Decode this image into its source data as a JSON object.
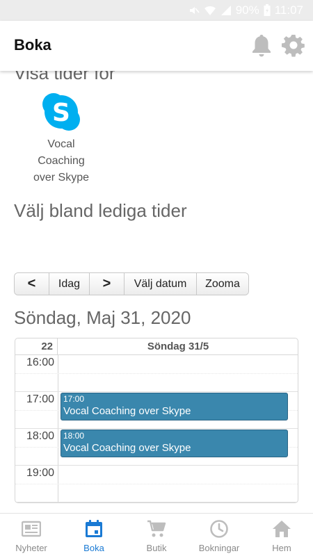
{
  "status_bar": {
    "battery": "90%",
    "time": "11:07"
  },
  "header": {
    "title": "Boka",
    "bell_icon": "bell-icon",
    "settings_icon": "gear-icon"
  },
  "main": {
    "visa_heading": "Visa tider för",
    "service": {
      "label": "Vocal Coaching over Skype",
      "icon": "skype-icon",
      "brand_color": "#00aff0"
    },
    "valj_heading": "Välj bland lediga tider",
    "toolbar": {
      "prev": "<",
      "today": "Idag",
      "next": ">",
      "pick_date": "Välj datum",
      "zoom": "Zooma"
    },
    "date_heading": "Söndag, Maj 31, 2020",
    "calendar": {
      "week_number": "22",
      "day_header": "Söndag 31/5",
      "hours": [
        "16:00",
        "17:00",
        "18:00",
        "19:00"
      ],
      "events": [
        {
          "time": "17:00",
          "title": "Vocal Coaching over Skype"
        },
        {
          "time": "18:00",
          "title": "Vocal Coaching over Skype"
        }
      ],
      "event_color": "#3a87ad"
    }
  },
  "bottom_nav": {
    "items": [
      {
        "label": "Nyheter",
        "icon": "newspaper-icon"
      },
      {
        "label": "Boka",
        "icon": "calendar-icon",
        "active": true
      },
      {
        "label": "Butik",
        "icon": "cart-icon"
      },
      {
        "label": "Bokningar",
        "icon": "clock-icon"
      },
      {
        "label": "Hem",
        "icon": "home-icon"
      }
    ],
    "active_color": "#1a7ad4"
  }
}
